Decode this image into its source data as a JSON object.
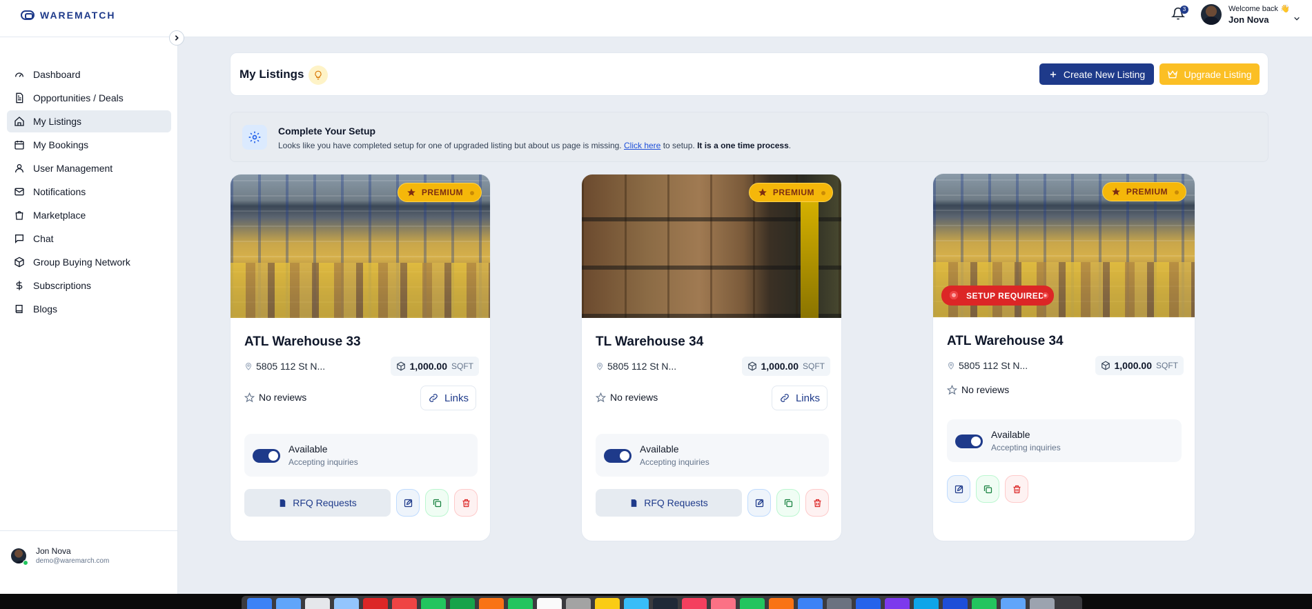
{
  "brand": {
    "name": "WAREMATCH"
  },
  "topbar": {
    "notification_count": "3",
    "welcome": "Welcome back 👋",
    "user_name": "Jon Nova"
  },
  "sidebar": {
    "items": [
      {
        "label": "Dashboard",
        "icon": "dashboard-icon"
      },
      {
        "label": "Opportunities / Deals",
        "icon": "document-icon"
      },
      {
        "label": "My Listings",
        "icon": "home-icon",
        "active": true
      },
      {
        "label": "My Bookings",
        "icon": "calendar-icon"
      },
      {
        "label": "User Management",
        "icon": "user-icon"
      },
      {
        "label": "Notifications",
        "icon": "mail-icon"
      },
      {
        "label": "Marketplace",
        "icon": "shopping-bag-icon"
      },
      {
        "label": "Chat",
        "icon": "chat-icon"
      },
      {
        "label": "Group Buying Network",
        "icon": "cube-icon"
      },
      {
        "label": "Subscriptions",
        "icon": "dollar-icon"
      },
      {
        "label": "Blogs",
        "icon": "book-icon"
      }
    ],
    "footer": {
      "name": "Jon Nova",
      "email": "demo@waremarch.com"
    }
  },
  "header": {
    "title": "My Listings",
    "create_label": "Create New Listing",
    "upgrade_label": "Upgrade Listing"
  },
  "setup": {
    "title": "Complete Your Setup",
    "text": "Looks like you have completed setup for one of upgraded listing but about us page is missing.",
    "link": "Click here",
    "after_link": " to setup. ",
    "emphasis": "It is a one time process",
    "period": "."
  },
  "listings": [
    {
      "name": "ATL Warehouse 33",
      "badge": "PREMIUM",
      "address": "5805 112 St N...",
      "area": "1,000.00",
      "unit": "SQFT",
      "reviews": "No reviews",
      "links_label": "Links",
      "available_title": "Available",
      "available_sub": "Accepting inquiries",
      "rfq_label": "RFQ Requests"
    },
    {
      "name": "TL Warehouse 34",
      "badge": "PREMIUM",
      "address": "5805 112 St N...",
      "area": "1,000.00",
      "unit": "SQFT",
      "reviews": "No reviews",
      "links_label": "Links",
      "available_title": "Available",
      "available_sub": "Accepting inquiries",
      "rfq_label": "RFQ Requests"
    },
    {
      "name": "ATL Warehouse 34",
      "badge": "PREMIUM",
      "status_badge": "SETUP REQUIRED",
      "address": "5805 112 St N...",
      "area": "1,000.00",
      "unit": "SQFT",
      "reviews": "No reviews",
      "available_title": "Available",
      "available_sub": "Accepting inquiries"
    }
  ],
  "colors": {
    "primary": "#1e3a8a",
    "premium": "#f5b70a",
    "danger": "#dc2626",
    "upgrade": "#fbbf24"
  }
}
